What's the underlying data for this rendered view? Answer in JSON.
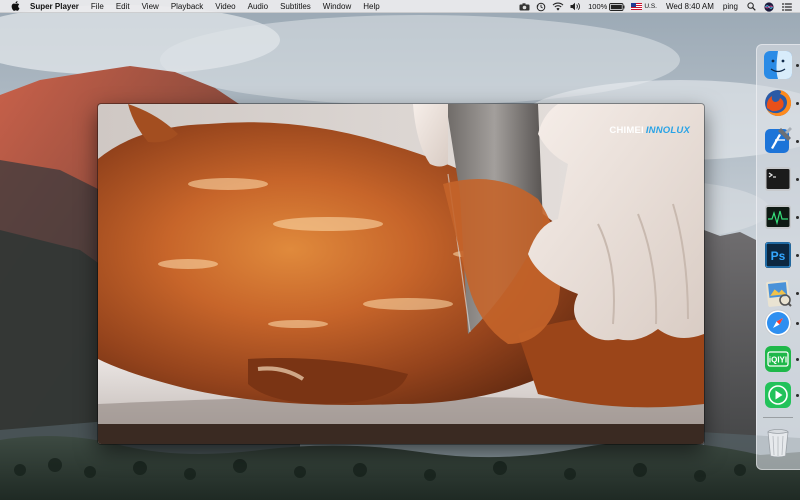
{
  "menubar": {
    "app_name": "Super Player",
    "items": [
      "File",
      "Edit",
      "View",
      "Playback",
      "Video",
      "Audio",
      "Subtitles",
      "Window",
      "Help"
    ],
    "status": {
      "battery": "100%",
      "input_source": "U.S.",
      "clock": "Wed 8:40 AM",
      "user": "ping"
    }
  },
  "player": {
    "watermark": {
      "brand_a": "CHIMEI",
      "brand_b": "INNOLUX"
    }
  },
  "dock": {
    "items": [
      {
        "name": "finder-icon",
        "running": true
      },
      {
        "name": "firefox-icon",
        "running": true
      },
      {
        "name": "xcode-icon",
        "running": true
      },
      {
        "name": "terminal-icon",
        "running": true
      },
      {
        "name": "activity-monitor-icon",
        "running": true
      },
      {
        "name": "photoshop-icon",
        "running": true
      },
      {
        "name": "preview-icon",
        "running": true
      },
      {
        "name": "safari-icon",
        "running": true
      },
      {
        "name": "iqiyi-icon",
        "running": true
      },
      {
        "name": "super-player-icon",
        "running": true
      },
      {
        "name": "trash-icon",
        "running": false
      }
    ],
    "labels": {
      "photoshop": "Ps",
      "iqiyi": "iQIYI"
    }
  },
  "colors": {
    "accent": "#29a3e6",
    "menubar_bg": "#ececee",
    "iqiyi_green": "#1db954"
  }
}
